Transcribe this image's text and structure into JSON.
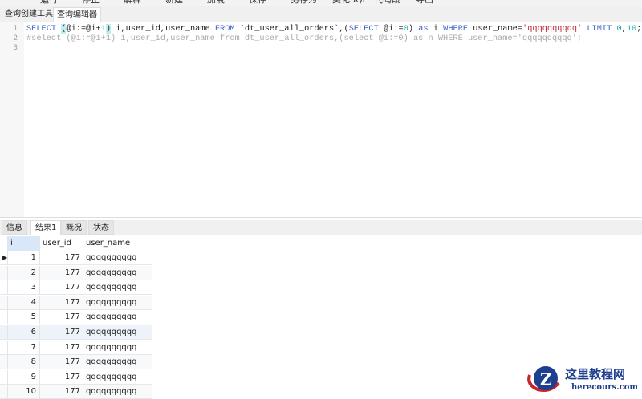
{
  "toolbar": {
    "items": [
      "运行",
      "停止",
      "解释",
      "新建",
      "加载",
      "保存",
      "另存为",
      "美化SQL",
      "代码段",
      "导出"
    ]
  },
  "query_tabs": [
    {
      "label": "查询创建工具"
    },
    {
      "label": "查询编辑器"
    }
  ],
  "editor": {
    "line_numbers": [
      "1",
      "2",
      "3"
    ],
    "line1": {
      "p1": "SELECT",
      "p2": "(",
      "p3": "@i:=@i+",
      "p4": "1",
      "p5": ")",
      "p6": " i,user_id,user_name ",
      "p7": "FROM",
      "p8": " `dt_user_all_orders`,(",
      "p9": "SELECT",
      "p10": " @i:=",
      "p11": "0",
      "p12": ") ",
      "p13": "as",
      "p14": " i ",
      "p15": "WHERE",
      "p16": " user_name=",
      "p17": "'qqqqqqqqqq'",
      "p18": " ",
      "p19": "LIMIT",
      "p20": " ",
      "p21": "0",
      "p22": ",",
      "p23": "10",
      "p24": ";"
    },
    "line2": "#select (@i:=@i+1) i,user_id,user_name from dt_user_all_orders,(select @i:=0) as n WHERE user_name='qqqqqqqqqq';"
  },
  "result_tabs": [
    {
      "label": "信息"
    },
    {
      "label": "结果1"
    },
    {
      "label": "概况"
    },
    {
      "label": "状态"
    }
  ],
  "grid": {
    "columns": [
      "i",
      "user_id",
      "user_name"
    ],
    "rows": [
      [
        "1",
        "177",
        "qqqqqqqqqq"
      ],
      [
        "2",
        "177",
        "qqqqqqqqqq"
      ],
      [
        "3",
        "177",
        "qqqqqqqqqq"
      ],
      [
        "4",
        "177",
        "qqqqqqqqqq"
      ],
      [
        "5",
        "177",
        "qqqqqqqqqq"
      ],
      [
        "6",
        "177",
        "qqqqqqqqqq"
      ],
      [
        "7",
        "177",
        "qqqqqqqqqq"
      ],
      [
        "8",
        "177",
        "qqqqqqqqqq"
      ],
      [
        "9",
        "177",
        "qqqqqqqqqq"
      ],
      [
        "10",
        "177",
        "qqqqqqqqqq"
      ]
    ]
  },
  "watermark": {
    "title": "这里教程网",
    "url": "herecours.com"
  }
}
